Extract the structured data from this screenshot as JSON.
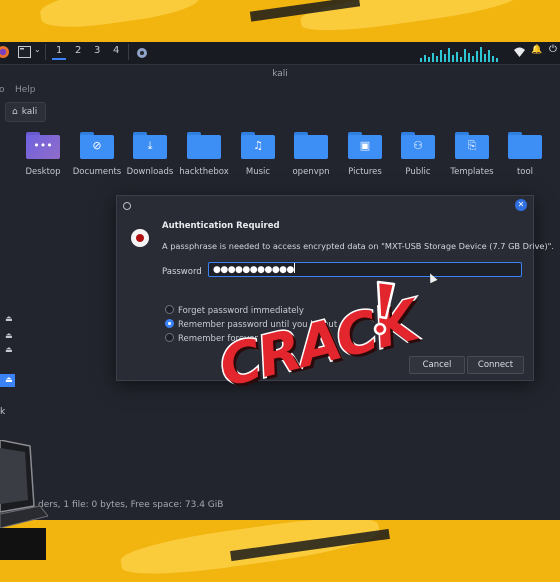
{
  "taskbar": {
    "workspaces": [
      "1",
      "2",
      "3",
      "4"
    ],
    "active_workspace": "1"
  },
  "window": {
    "title": "kali",
    "menu": [
      "o",
      "Help"
    ],
    "location_button": "kali"
  },
  "files": [
    {
      "label": "Desktop",
      "icon": "desktop-folder-icon"
    },
    {
      "label": "Documents",
      "icon": "paperclip-icon"
    },
    {
      "label": "Downloads",
      "icon": "download-icon"
    },
    {
      "label": "hackthebox",
      "icon": "folder-icon"
    },
    {
      "label": "Music",
      "icon": "music-note-icon"
    },
    {
      "label": "openvpn",
      "icon": "folder-icon"
    },
    {
      "label": "Pictures",
      "icon": "image-icon"
    },
    {
      "label": "Public",
      "icon": "people-icon"
    },
    {
      "label": "Templates",
      "icon": "template-icon"
    },
    {
      "label": "tool",
      "icon": "folder-icon"
    }
  ],
  "sidebar": {
    "partial_label": "k"
  },
  "statusbar": {
    "text": "ders, 1 file: 0 bytes, Free space: 73.4 GiB"
  },
  "dialog": {
    "title": "Authentication Required",
    "message": "A passphrase is needed to access encrypted data on \"MXT-USB Storage Device (7.7 GB Drive)\".",
    "password_label": "Password",
    "password_value": "●●●●●●●●●●●",
    "options": [
      {
        "label": "Forget password immediately",
        "selected": false
      },
      {
        "label": "Remember password until you logout",
        "selected": true
      },
      {
        "label": "Remember forever",
        "selected": false
      }
    ],
    "cancel_label": "Cancel",
    "connect_label": "Connect"
  },
  "overlay": {
    "text": "CRACK"
  },
  "colors": {
    "accent": "#3b82f6",
    "background": "#f2b40f",
    "overlay_text": "#e3262d"
  }
}
